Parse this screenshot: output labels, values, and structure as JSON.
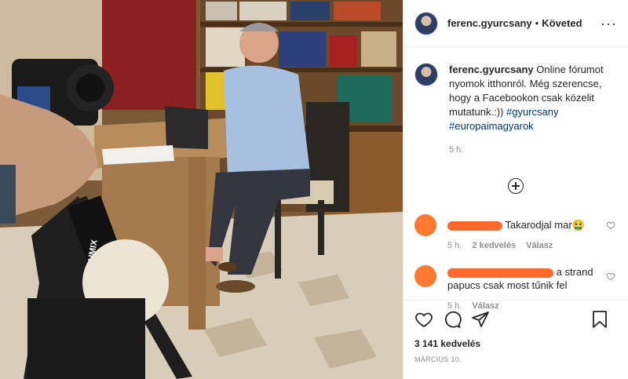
{
  "post": {
    "username": "ferenc.gyurcsany",
    "separator": "•",
    "follow_status": "Követed",
    "caption_text": "Online fórumot nyomok itthonról. Még szerencse, hogy a Facebookon csak közelit mutatunk.:))",
    "hashtags": [
      "#gyurcsany",
      "#europaimagyarok"
    ],
    "time": "5 h.",
    "likes": "3 141 kedvelés",
    "date": "MÁRCIUS 10.",
    "camera_brand": "LUMIX"
  },
  "comments": [
    {
      "text": "Takarodjal mar🤮",
      "time": "5 h.",
      "likes": "2 kedvelés",
      "reply": "Válasz"
    },
    {
      "text_a": "a strand",
      "text_b": "papucs csak most tűnik fel",
      "time": "5 h.",
      "reply": "Válasz"
    }
  ],
  "colors": {
    "redaction": "#ff6a2a",
    "hashtag": "#00376b",
    "muted": "#8e8e8e"
  }
}
